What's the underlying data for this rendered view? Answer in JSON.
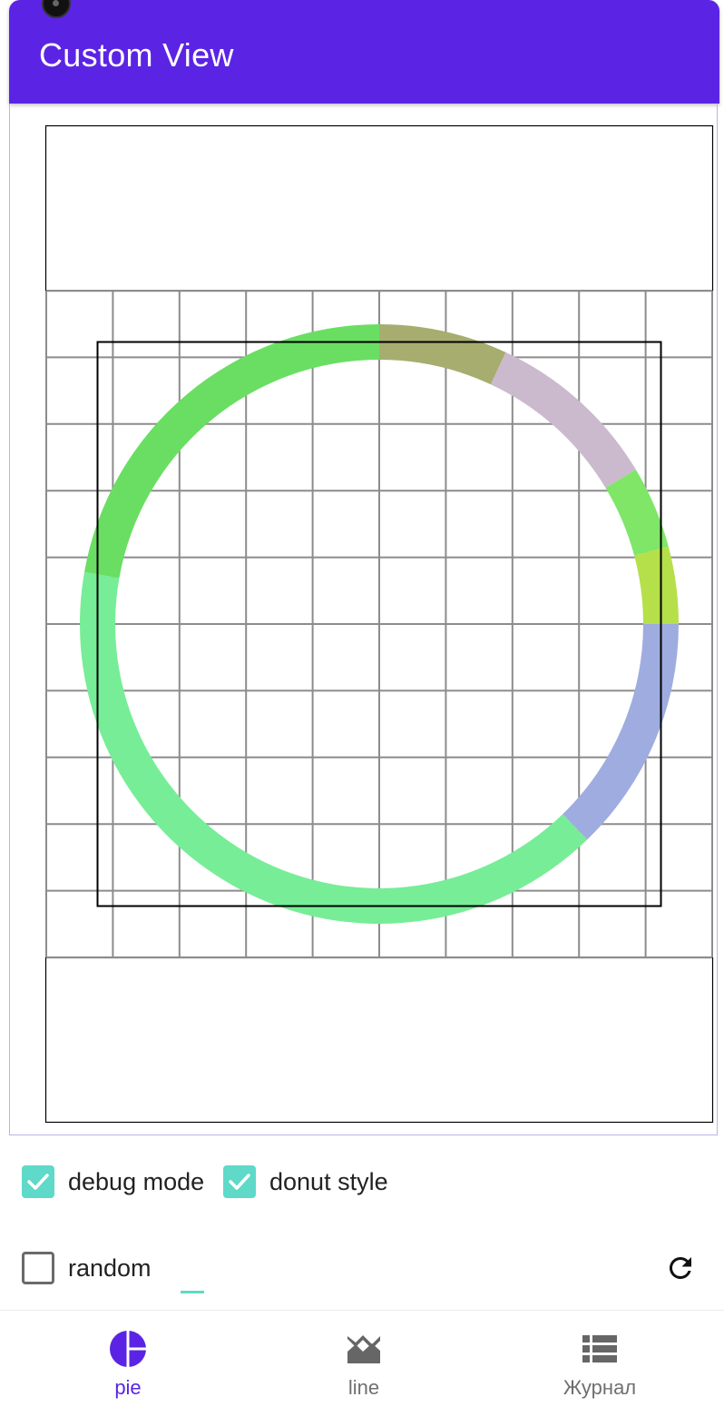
{
  "app_bar": {
    "title": "Custom View",
    "background": "#5b24e4"
  },
  "pie_view": {
    "icon": "donut-chart",
    "debug_grid": true,
    "segments": [
      {
        "color": "#a7ad6f",
        "sweep_deg": 25
      },
      {
        "color": "#cbb9ce",
        "sweep_deg": 34
      },
      {
        "color": "#7fe667",
        "sweep_deg": 16
      },
      {
        "color": "#b5e04a",
        "sweep_deg": 15
      },
      {
        "color": "#9eace0",
        "sweep_deg": 46
      },
      {
        "color": "#77ed97",
        "sweep_deg": 144
      },
      {
        "color": "#6ade62",
        "sweep_deg": 80
      }
    ]
  },
  "controls": {
    "debug_mode": {
      "label": "debug mode",
      "checked": true
    },
    "donut_style": {
      "label": "donut style",
      "checked": true
    },
    "random": {
      "label": "random",
      "checked": false
    },
    "refresh_icon": "refresh-icon",
    "accent": "#5fd9c8"
  },
  "bottom_nav": {
    "active_color": "#5b24e4",
    "items": [
      {
        "label": "pie",
        "icon": "pie-chart-icon",
        "active": true
      },
      {
        "label": "line",
        "icon": "line-chart-icon",
        "active": false
      },
      {
        "label": "Журнал",
        "icon": "list-icon",
        "active": false
      }
    ]
  }
}
